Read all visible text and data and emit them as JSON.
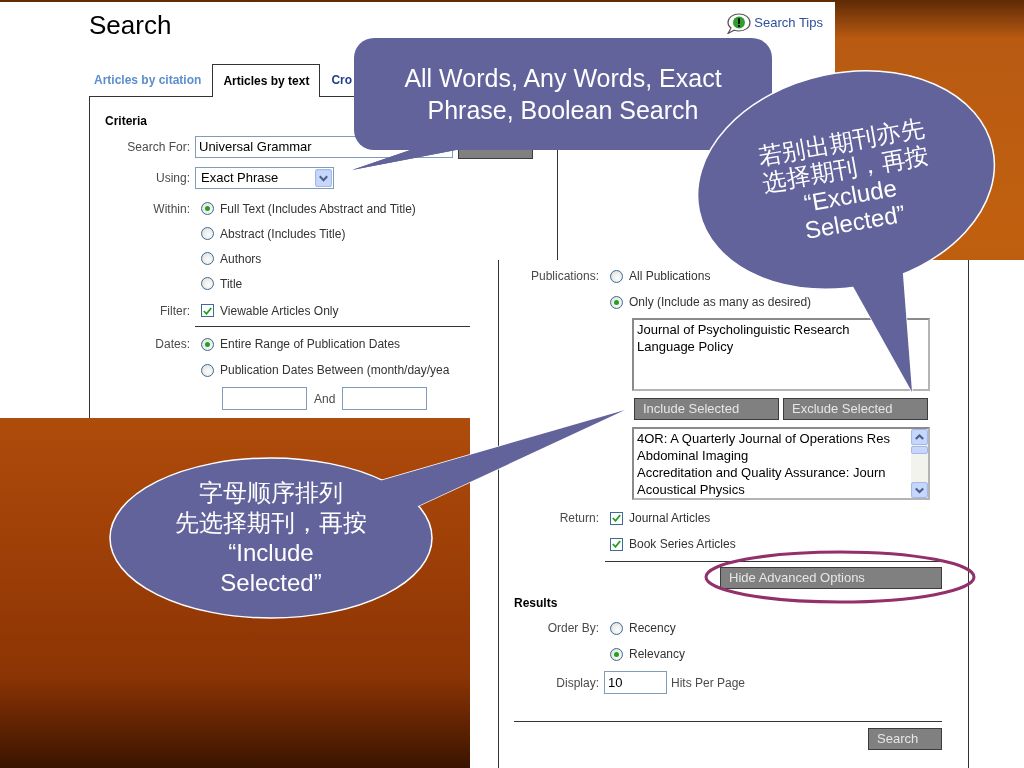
{
  "search_page": {
    "title": "Search",
    "tips_link": "Search Tips",
    "tabs": [
      {
        "label": "Articles by citation",
        "selected": false,
        "visited": true
      },
      {
        "label": "Articles by text",
        "selected": true
      },
      {
        "label": "Cro",
        "selected": false,
        "visited": false
      }
    ],
    "criteria": {
      "heading": "Criteria",
      "search_for": {
        "label": "Search For:",
        "value": "Universal Grammar"
      },
      "using": {
        "label": "Using:",
        "value": "Exact Phrase"
      },
      "within": {
        "label": "Within:",
        "options": [
          {
            "label": "Full Text (Includes Abstract and Title)",
            "selected": true
          },
          {
            "label": "Abstract (Includes Title)",
            "selected": false
          },
          {
            "label": "Authors",
            "selected": false
          },
          {
            "label": "Title",
            "selected": false
          }
        ]
      },
      "filter": {
        "label": "Filter:",
        "options": [
          {
            "label": "Viewable Articles Only",
            "checked": true
          }
        ]
      },
      "dates": {
        "label": "Dates:",
        "options": [
          {
            "label": "Entire Range of Publication Dates",
            "selected": true
          },
          {
            "label": "Publication Dates Between (month/day/yea",
            "selected": false
          }
        ],
        "range_joiner": "And"
      }
    }
  },
  "advanced_options": {
    "publications": {
      "label": "Publications:",
      "options": [
        {
          "label": "All Publications",
          "selected": false
        },
        {
          "label": "Only (Include as many as desired)",
          "selected": true
        }
      ],
      "selected_list": [
        "Journal of Psycholinguistic Research",
        "Language Policy"
      ],
      "buttons": [
        "Include Selected",
        "Exclude Selected"
      ],
      "catalog_list": [
        "4OR: A Quarterly Journal of Operations Res",
        "Abdominal Imaging",
        "Accreditation and Quality Assurance: Journ",
        "Acoustical Physics"
      ]
    },
    "return": {
      "label": "Return:",
      "options": [
        {
          "label": "Journal Articles",
          "checked": true
        },
        {
          "label": "Book Series Articles",
          "checked": true
        }
      ]
    },
    "hide_button": {
      "label": "Hide Advanced Options",
      "circled": true
    },
    "results": {
      "heading": "Results",
      "order_by": {
        "label": "Order By:",
        "options": [
          {
            "label": "Recency",
            "selected": false
          },
          {
            "label": "Relevancy",
            "selected": true
          }
        ]
      },
      "display": {
        "label": "Display:",
        "value": "10",
        "suffix": "Hits Per Page"
      }
    },
    "search_button": "Search"
  },
  "callouts": [
    {
      "kind": "rounded",
      "lines": [
        "All Words, Any Words, Exact",
        "Phrase, Boolean Search"
      ]
    },
    {
      "kind": "ellipse",
      "lines": [
        "若别出期刊亦先",
        "选择期刊，再按",
        "“Exclude",
        "Selected”"
      ]
    },
    {
      "kind": "ellipse",
      "lines": [
        "字母顺序排列",
        "先选择期刊，再按",
        "“Include",
        "Selected”"
      ]
    }
  ]
}
